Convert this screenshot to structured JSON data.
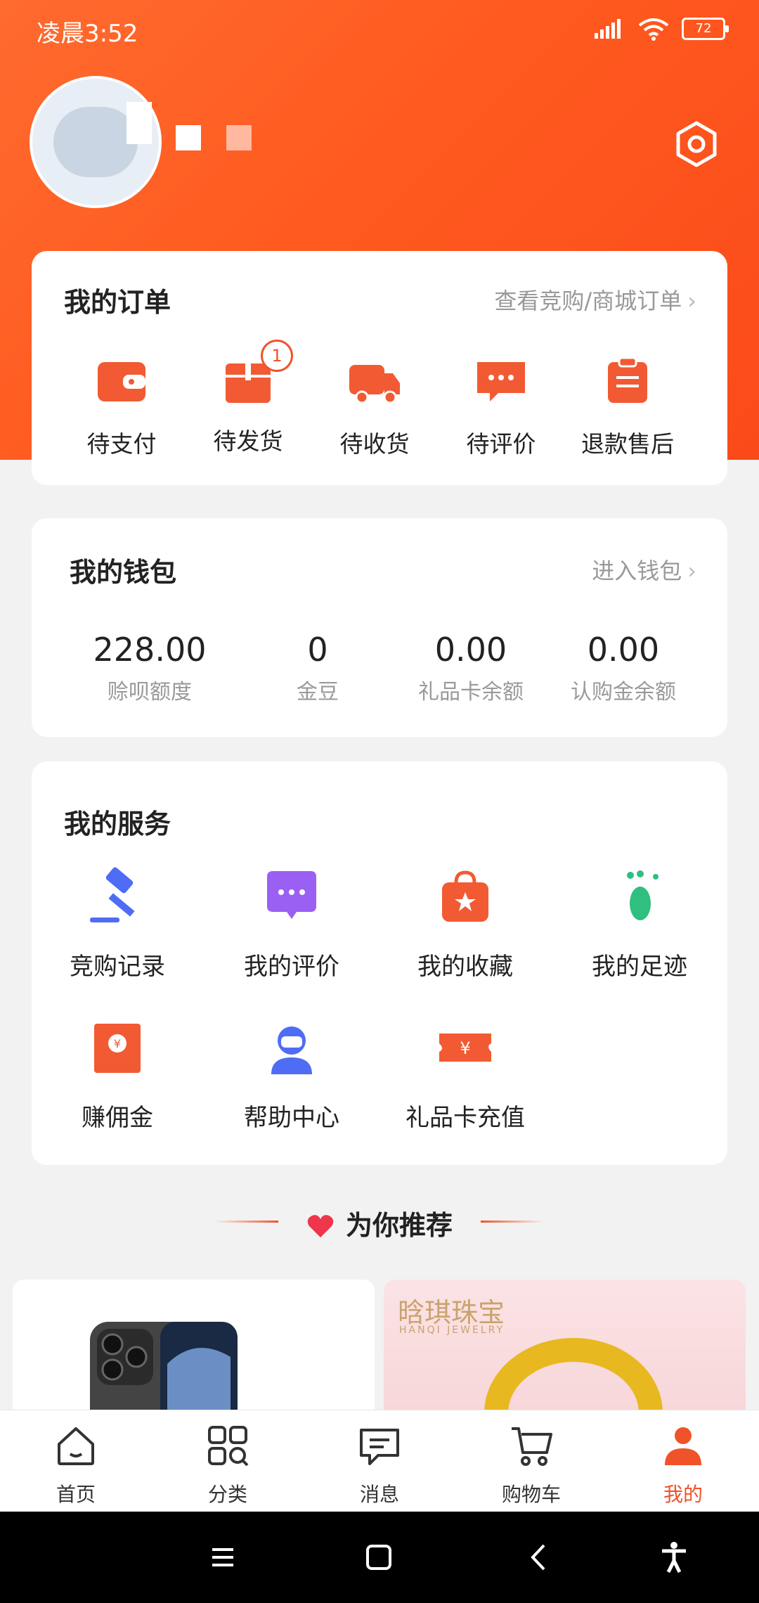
{
  "status": {
    "time": "凌晨3:52",
    "battery": "72"
  },
  "orders": {
    "title": "我的订单",
    "link": "查看竞购/商城订单",
    "items": [
      {
        "label": "待支付",
        "icon": "wallet-icon"
      },
      {
        "label": "待发货",
        "icon": "box-icon",
        "badge": "1"
      },
      {
        "label": "待收货",
        "icon": "truck-icon"
      },
      {
        "label": "待评价",
        "icon": "chat-icon"
      },
      {
        "label": "退款售后",
        "icon": "clipboard-icon"
      }
    ]
  },
  "wallet": {
    "title": "我的钱包",
    "link": "进入钱包",
    "items": [
      {
        "value": "228.00",
        "caption": "赊呗额度"
      },
      {
        "value": "0",
        "caption": "金豆"
      },
      {
        "value": "0.00",
        "caption": "礼品卡余额"
      },
      {
        "value": "0.00",
        "caption": "认购金余额"
      }
    ]
  },
  "services": {
    "title": "我的服务",
    "items": [
      {
        "label": "竞购记录",
        "icon": "gavel-icon"
      },
      {
        "label": "我的评价",
        "icon": "comment-icon"
      },
      {
        "label": "我的收藏",
        "icon": "bag-star-icon"
      },
      {
        "label": "我的足迹",
        "icon": "footprint-icon"
      },
      {
        "label": "赚佣金",
        "icon": "red-envelope-icon"
      },
      {
        "label": "帮助中心",
        "icon": "support-agent-icon"
      },
      {
        "label": "礼品卡充值",
        "icon": "ticket-icon"
      }
    ]
  },
  "recommend": {
    "title": "为你推荐"
  },
  "products": [
    {
      "name": "phone"
    },
    {
      "brand": "晗琪珠宝",
      "brand_sub": "HANQI JEWELRY"
    }
  ],
  "tabs": [
    {
      "label": "首页",
      "icon": "home-icon"
    },
    {
      "label": "分类",
      "icon": "grid-icon"
    },
    {
      "label": "消息",
      "icon": "message-icon"
    },
    {
      "label": "购物车",
      "icon": "cart-icon"
    },
    {
      "label": "我的",
      "icon": "user-icon",
      "active": true
    }
  ],
  "colors": {
    "accent": "#f0532a",
    "hero": "#ff5a1f"
  }
}
